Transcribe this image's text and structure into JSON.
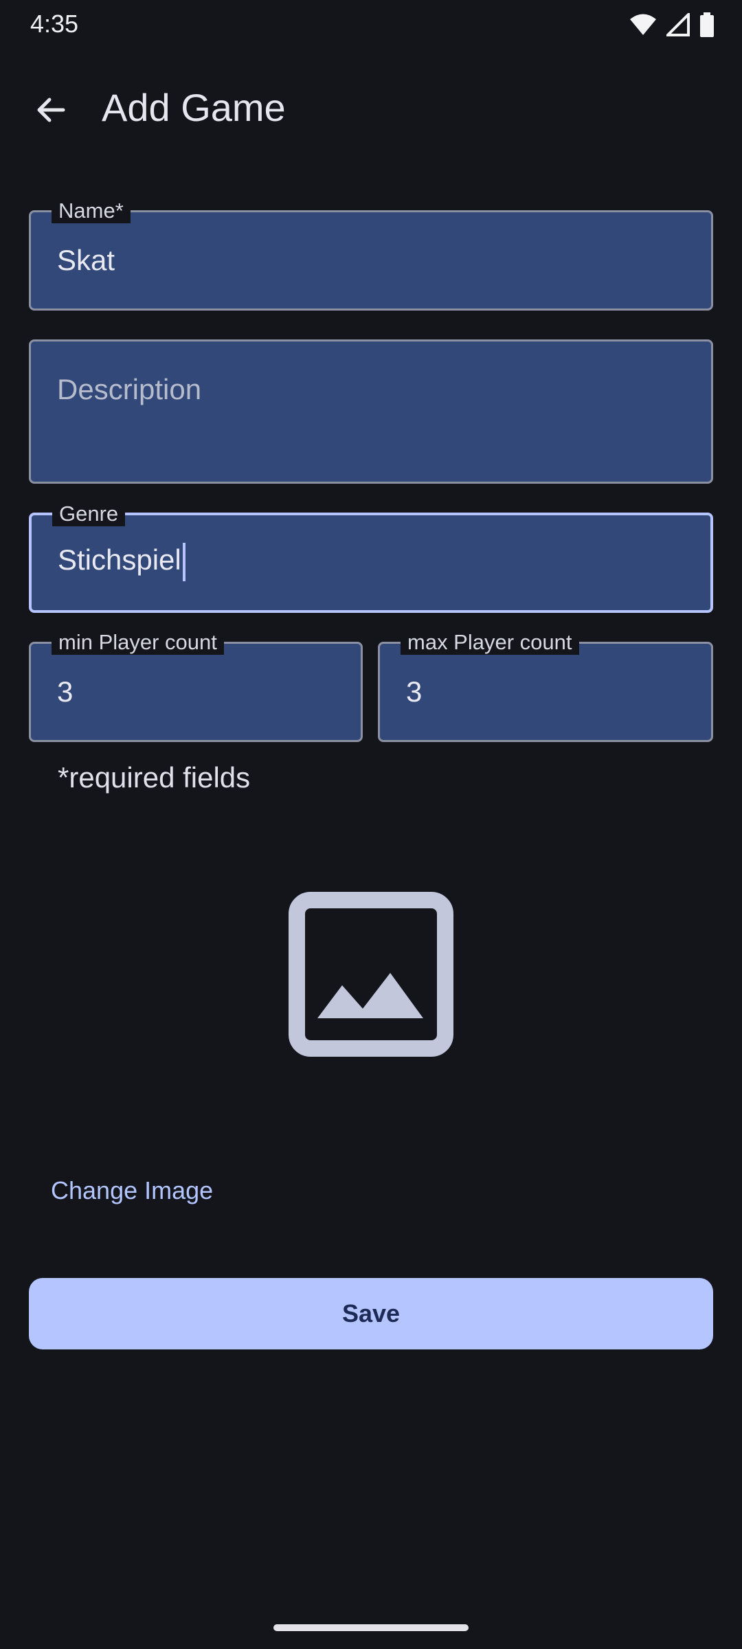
{
  "status_bar": {
    "time": "4:35",
    "icons": [
      "wifi-icon",
      "cell-signal-icon",
      "battery-icon"
    ]
  },
  "app_bar": {
    "back_icon": "arrow-back-icon",
    "title": "Add Game"
  },
  "form": {
    "name": {
      "label": "Name*",
      "value": "Skat"
    },
    "description": {
      "label": "",
      "placeholder": "Description",
      "value": ""
    },
    "genre": {
      "label": "Genre",
      "value": "Stichspiel",
      "focused": true
    },
    "min_players": {
      "label": "min Player count",
      "value": "3"
    },
    "max_players": {
      "label": "max Player count",
      "value": "3"
    },
    "required_note": "*required fields"
  },
  "image": {
    "icon": "image-placeholder-icon"
  },
  "actions": {
    "change_image": "Change Image",
    "save": "Save"
  },
  "colors": {
    "background": "#13151b",
    "field_fill": "#314879",
    "accent": "#b4c5ff",
    "link": "#b3c5ff"
  }
}
